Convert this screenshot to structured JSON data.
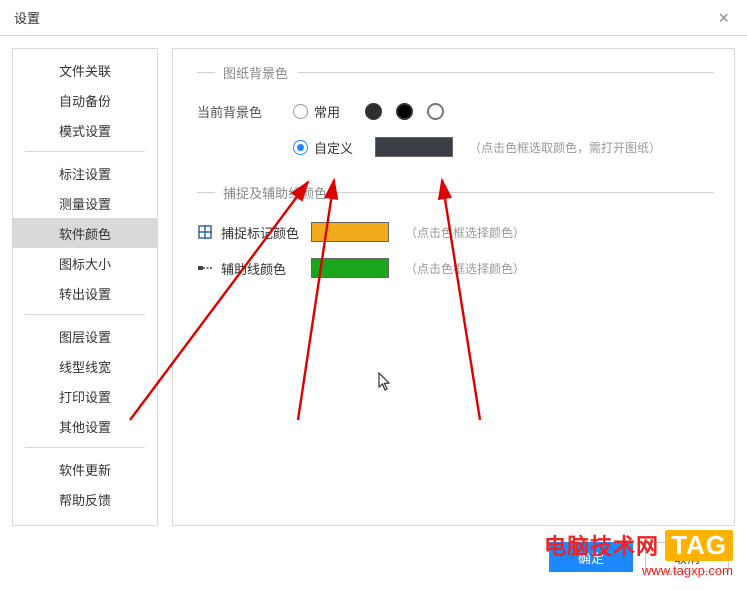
{
  "title": "设置",
  "sidebar": {
    "groups": [
      [
        "文件关联",
        "自动备份",
        "模式设置"
      ],
      [
        "标注设置",
        "测量设置",
        "软件颜色",
        "图标大小",
        "转出设置"
      ],
      [
        "图层设置",
        "线型线宽",
        "打印设置",
        "其他设置"
      ],
      [
        "软件更新",
        "帮助反馈"
      ]
    ],
    "active": "软件颜色"
  },
  "sections": {
    "bgColor": {
      "legend": "图纸背景色",
      "currentLabel": "当前背景色",
      "commonLabel": "常用",
      "customLabel": "自定义",
      "presetColors": [
        "#2e2e2e",
        "#000000"
      ],
      "customSwatch": "#3a3f45",
      "customHint": "（点击色框选取颜色，需打开图纸）"
    },
    "snap": {
      "legend": "捕捉及辅助线颜色",
      "rows": [
        {
          "icon": "snap-marker-icon",
          "label": "捕捉标记颜色",
          "color": "#f1aa1c",
          "hint": "（点击色框选择颜色）"
        },
        {
          "icon": "guide-line-icon",
          "label": "辅助线颜色",
          "color": "#1aa61a",
          "hint": "（点击色框选择颜色）"
        }
      ]
    }
  },
  "buttons": {
    "ok": "确定",
    "cancel": "取消"
  },
  "watermark": {
    "line1": "电脑技术网",
    "tag": "TAG",
    "line2": "www.tagxp.com"
  }
}
